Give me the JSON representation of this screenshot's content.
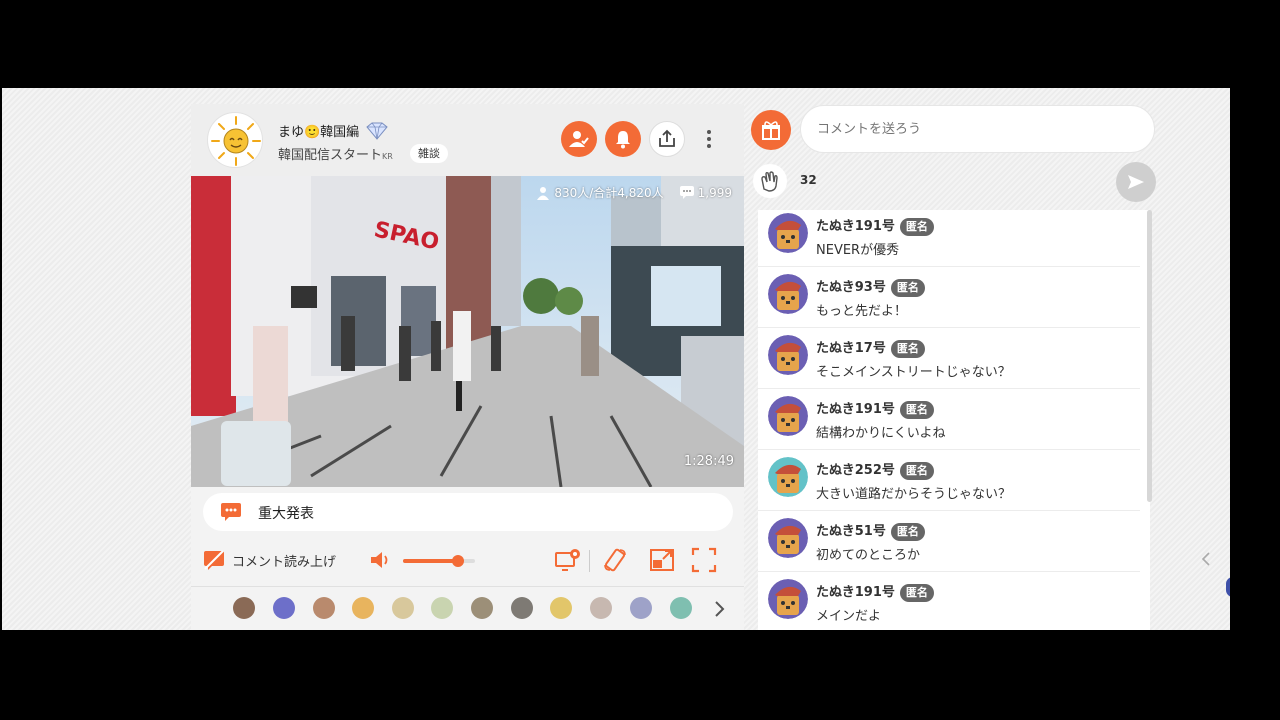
{
  "broadcaster": {
    "name": "まゆ🙂韓国編",
    "title": "韓国配信スタート",
    "country": "KR",
    "category": "雑談"
  },
  "video": {
    "viewers": "830人/合計4,820人",
    "comments": "1,999",
    "elapsed": "1:28:49"
  },
  "notice": {
    "text": "重大発表"
  },
  "controls": {
    "tts_label": "コメント読み上げ",
    "volume": 0.76
  },
  "chat": {
    "input_placeholder": "コメントを送ろう",
    "clap_count": "32",
    "anon_label": "匿名",
    "messages": [
      {
        "user": "たぬき191号",
        "text": "NEVERが優秀"
      },
      {
        "user": "たぬき93号",
        "text": "もっと先だよ！"
      },
      {
        "user": "たぬき17号",
        "text": "そこメインストリートじゃない？"
      },
      {
        "user": "たぬき191号",
        "text": "結構わかりにくいよね"
      },
      {
        "user": "たぬき252号",
        "text": "大きい道路だからそうじゃない？"
      },
      {
        "user": "たぬき51号",
        "text": "初めてのところか"
      },
      {
        "user": "たぬき191号",
        "text": "メインだよ"
      }
    ]
  },
  "colors": {
    "accent": "#f36b36",
    "badge": "#666666"
  },
  "icons": {
    "header": [
      "follow-icon",
      "bell-icon",
      "share-icon",
      "more-icon"
    ],
    "controls": [
      "tts-off-icon",
      "speaker-icon",
      "settings-icon",
      "rotate-icon",
      "pip-icon",
      "fullscreen-icon"
    ],
    "emoji_strip": [
      "emoji-tanuki",
      "emoji-galaxy",
      "emoji-bowl",
      "emoji-cake",
      "emoji-bus",
      "emoji-box",
      "emoji-bottles",
      "emoji-bottles-dark",
      "emoji-heart-box",
      "emoji-glasses",
      "emoji-trophy",
      "emoji-phone"
    ]
  }
}
